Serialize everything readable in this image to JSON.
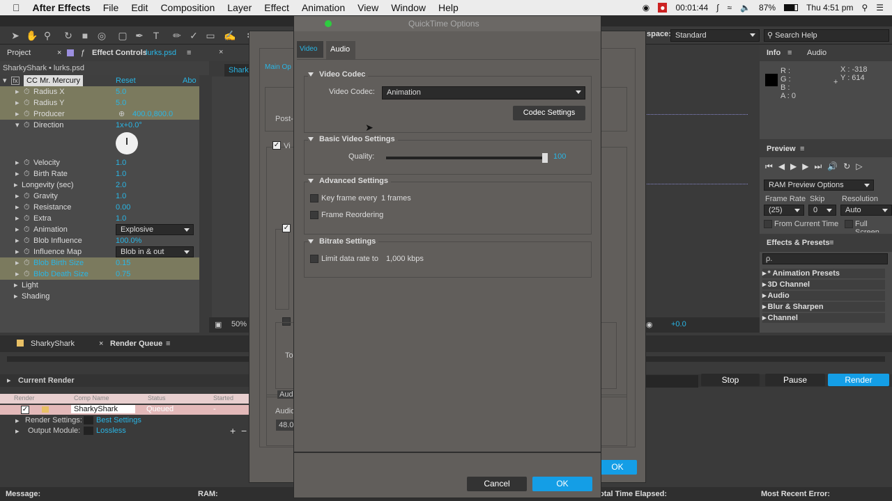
{
  "menubar": {
    "apple_icon": "apple-icon",
    "app_name": "After Effects",
    "items": [
      "File",
      "Edit",
      "Composition",
      "Layer",
      "Effect",
      "Animation",
      "View",
      "Window",
      "Help"
    ],
    "timer": "00:01:44",
    "battery": "87%",
    "clock": "Thu 4:51 pm"
  },
  "toolbar": {
    "workspace_label": "space:",
    "workspace_value": "Standard",
    "search_help": "Search Help"
  },
  "project_panel": {
    "tab_project": "Project",
    "tab_effect_controls": "Effect Controls",
    "effect_file": "lurks.psd",
    "breadcrumb": "SharkyShark • lurks.psd",
    "effect_name": "CC Mr. Mercury",
    "reset": "Reset",
    "about": "Abo",
    "properties": [
      {
        "label": "Radius X",
        "value": "5.0"
      },
      {
        "label": "Radius Y",
        "value": "5.0"
      },
      {
        "label": "Producer",
        "value": "400.0,800.0"
      },
      {
        "label": "Direction",
        "value": "1x+0.0°"
      },
      {
        "label": "Velocity",
        "value": "1.0"
      },
      {
        "label": "Birth Rate",
        "value": "1.0"
      },
      {
        "label": "Longevity (sec)",
        "value": "2.0"
      },
      {
        "label": "Gravity",
        "value": "1.0"
      },
      {
        "label": "Resistance",
        "value": "0.00"
      },
      {
        "label": "Extra",
        "value": "1.0"
      },
      {
        "label": "Animation",
        "value": "Explosive"
      },
      {
        "label": "Blob Influence",
        "value": "100.0%"
      },
      {
        "label": "Influence Map",
        "value": "Blob in & out"
      },
      {
        "label": "Blob Birth Size",
        "value": "0.15"
      },
      {
        "label": "Blob Death Size",
        "value": "0.75"
      },
      {
        "label": "Light",
        "value": ""
      },
      {
        "label": "Shading",
        "value": ""
      }
    ]
  },
  "comp_panel": {
    "tab": "Shark",
    "zoom": "50%",
    "exposure": "+0.0"
  },
  "info_panel": {
    "tab_info": "Info",
    "tab_audio": "Audio",
    "r": "R :",
    "g": "G :",
    "b": "B :",
    "a": "A : 0",
    "x": "X : -318",
    "y": "Y : 614"
  },
  "preview_panel": {
    "title": "Preview",
    "ram_options": "RAM Preview Options",
    "frame_rate_label": "Frame Rate",
    "skip_label": "Skip",
    "resolution_label": "Resolution",
    "frame_rate_value": "(25)",
    "skip_value": "0",
    "resolution_value": "Auto",
    "from_current": "From Current Time",
    "full_screen": "Full Screen"
  },
  "effects_panel": {
    "title": "Effects & Presets",
    "search_placeholder": "ρ.",
    "items": [
      "* Animation Presets",
      "3D Channel",
      "Audio",
      "Blur & Sharpen",
      "Channel"
    ]
  },
  "render_queue": {
    "tab_comp": "SharkyShark",
    "tab_rq": "Render Queue",
    "current_render": "Current Render",
    "stop": "Stop",
    "pause": "Pause",
    "render": "Render",
    "col_render": "Render",
    "col_comp": "Comp Name",
    "col_status": "Status",
    "col_started": "Started",
    "item_comp": "SharkyShark",
    "item_status": "Queued",
    "item_started": "-",
    "render_settings_label": "Render Settings:",
    "render_settings_value": "Best Settings",
    "output_module_label": "Output Module:",
    "output_module_value": "Lossless",
    "message": "Message:",
    "ram": "RAM:",
    "elapsed": "otal Time Elapsed:",
    "recent_error": "Most Recent Error:"
  },
  "bg_dialog": {
    "main_options": "Main Op",
    "post": "Post-",
    "video": "Vi",
    "to": "To",
    "audio": "Audi",
    "audio2": "Audio",
    "rate": "48.0",
    "ok": "OK"
  },
  "dialog": {
    "title": "QuickTime Options",
    "tab_video": "Video",
    "tab_audio": "Audio",
    "video_codec_section": "Video Codec",
    "video_codec_label": "Video Codec:",
    "video_codec_value": "Animation",
    "codec_settings": "Codec Settings",
    "basic_section": "Basic Video Settings",
    "quality_label": "Quality:",
    "quality_value": "100",
    "quality_fraction": 1.0,
    "advanced_section": "Advanced Settings",
    "keyframe_label": "Key frame every",
    "keyframe_value": "1 frames",
    "frame_reorder": "Frame Reordering",
    "bitrate_section": "Bitrate Settings",
    "limit_label": "Limit data rate to",
    "limit_value": "1,000 kbps",
    "cancel": "Cancel",
    "ok": "OK"
  }
}
